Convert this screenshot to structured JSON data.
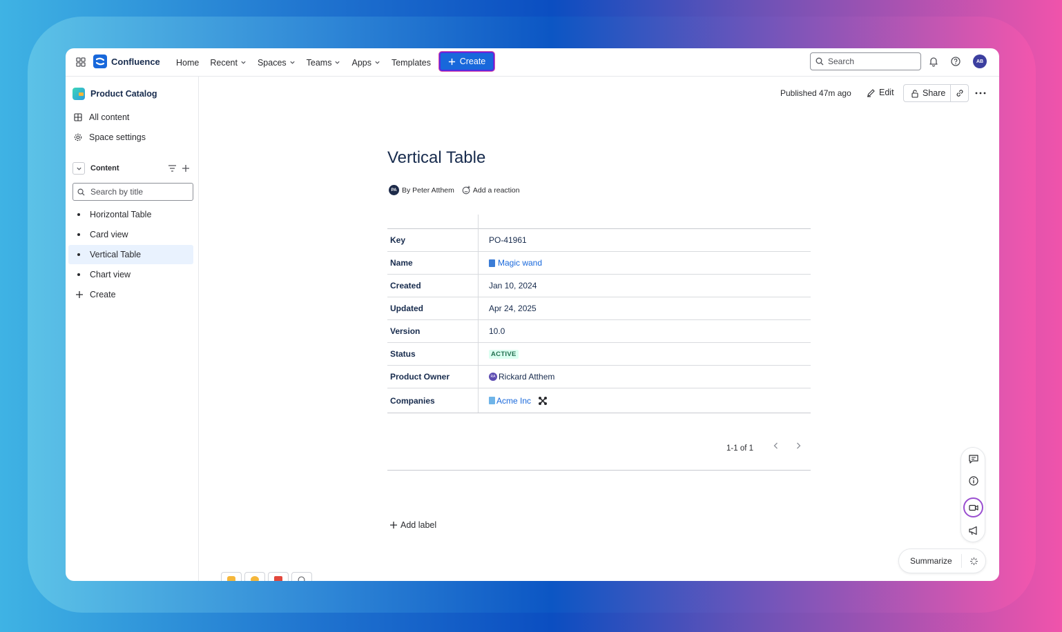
{
  "nav": {
    "brand": "Confluence",
    "links": [
      {
        "label": "Home",
        "chevron": false
      },
      {
        "label": "Recent",
        "chevron": true
      },
      {
        "label": "Spaces",
        "chevron": true
      },
      {
        "label": "Teams",
        "chevron": true
      },
      {
        "label": "Apps",
        "chevron": true
      },
      {
        "label": "Templates",
        "chevron": false
      }
    ],
    "create_label": "Create",
    "search_placeholder": "Search",
    "user_initials": "AB"
  },
  "sidebar": {
    "space_title": "Product Catalog",
    "items": [
      {
        "label": "All content",
        "icon": "grid-icon"
      },
      {
        "label": "Space settings",
        "icon": "gear-icon"
      }
    ],
    "content_label": "Content",
    "search_placeholder": "Search by title",
    "tree": [
      {
        "label": "Horizontal Table",
        "active": false
      },
      {
        "label": "Card view",
        "active": false
      },
      {
        "label": "Vertical Table",
        "active": true
      },
      {
        "label": "Chart view",
        "active": false
      }
    ],
    "create_label": "Create"
  },
  "page": {
    "published": "Published 47m ago",
    "edit_label": "Edit",
    "share_label": "Share",
    "title": "Vertical Table",
    "author_initials": "PA",
    "byline": "By Peter Atthem",
    "reaction_label": "Add a reaction",
    "table": {
      "rows": [
        {
          "key": "Key",
          "value": "PO-41961"
        },
        {
          "key": "Name",
          "value": "Magic wand"
        },
        {
          "key": "Created",
          "value": "Jan 10, 2024"
        },
        {
          "key": "Updated",
          "value": "Apr 24, 2025"
        },
        {
          "key": "Version",
          "value": "10.0"
        },
        {
          "key": "Status",
          "value": "ACTIVE"
        },
        {
          "key": "Product Owner",
          "value": "Rickard Atthem",
          "initials": "RA"
        },
        {
          "key": "Companies",
          "value": "Acme Inc"
        }
      ]
    },
    "pager": "1-1 of 1",
    "add_label": "Add label",
    "summarize_label": "Summarize"
  },
  "colors": {
    "brand_blue": "#1868db",
    "status_green_bg": "#dcfff1",
    "status_green_text": "#216e4e",
    "active_nav_bg": "#e9f2fe",
    "record_ring": "#9a4fd0"
  }
}
